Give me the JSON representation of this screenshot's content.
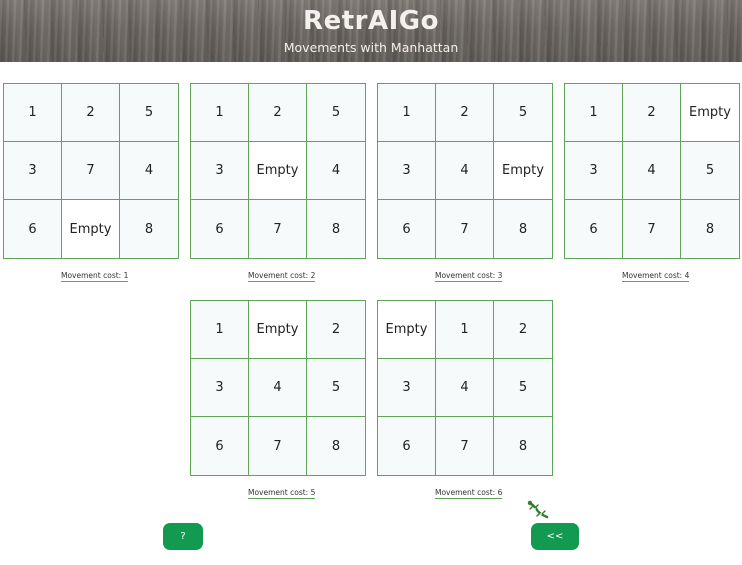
{
  "header": {
    "title": "RetrAIGo",
    "subtitle": "Movements with Manhattan"
  },
  "boards": [
    {
      "cells": [
        "1",
        "2",
        "5",
        "3",
        "7",
        "4",
        "6",
        "Empty",
        "8"
      ],
      "cost_label": "Movement cost: 1"
    },
    {
      "cells": [
        "1",
        "2",
        "5",
        "3",
        "Empty",
        "4",
        "6",
        "7",
        "8"
      ],
      "cost_label": "Movement cost: 2"
    },
    {
      "cells": [
        "1",
        "2",
        "5",
        "3",
        "4",
        "Empty",
        "6",
        "7",
        "8"
      ],
      "cost_label": "Movement cost: 3"
    },
    {
      "cells": [
        "1",
        "2",
        "Empty",
        "3",
        "4",
        "5",
        "6",
        "7",
        "8"
      ],
      "cost_label": "Movement cost: 4"
    },
    {
      "cells": [
        "1",
        "Empty",
        "2",
        "3",
        "4",
        "5",
        "6",
        "7",
        "8"
      ],
      "cost_label": "Movement cost: 5"
    },
    {
      "cells": [
        "Empty",
        "1",
        "2",
        "3",
        "4",
        "5",
        "6",
        "7",
        "8"
      ],
      "cost_label": "Movement cost: 6"
    }
  ],
  "buttons": {
    "help_label": "?",
    "back_label": "<<"
  },
  "icons": {
    "gecko": "gecko-icon"
  },
  "colors": {
    "grid_line": "#62a35a",
    "button": "#129b50",
    "cell_bg": "#f6fafb"
  }
}
